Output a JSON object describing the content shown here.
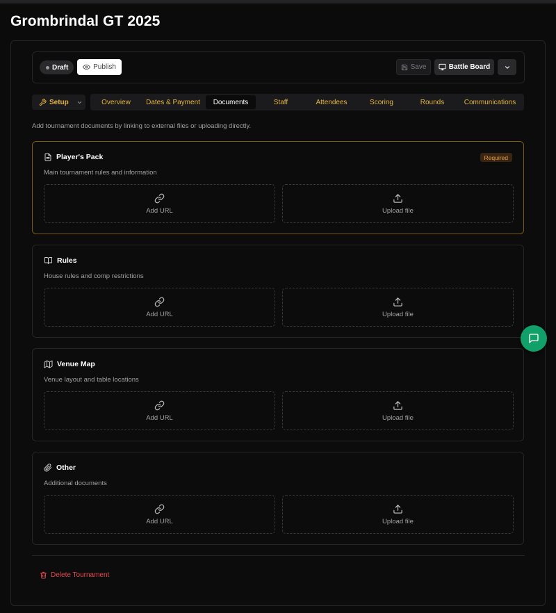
{
  "page": {
    "title": "Grombrindal GT 2025"
  },
  "toolbar": {
    "status_label": "Draft",
    "publish_label": "Publish",
    "save_label": "Save",
    "battle_board_label": "Battle Board"
  },
  "nav": {
    "setup_label": "Setup",
    "tabs": [
      {
        "label": "Overview"
      },
      {
        "label": "Dates & Payment"
      },
      {
        "label": "Documents"
      },
      {
        "label": "Staff"
      },
      {
        "label": "Attendees"
      },
      {
        "label": "Scoring"
      },
      {
        "label": "Rounds"
      },
      {
        "label": "Communications"
      }
    ],
    "active_tab": "Documents"
  },
  "intro": "Add tournament documents by linking to external files or uploading directly.",
  "documents": [
    {
      "title": "Player's Pack",
      "subtitle": "Main tournament rules and information",
      "badge": "Required",
      "icon": "file-text-icon",
      "url_label": "Add URL",
      "upload_label": "Upload file"
    },
    {
      "title": "Rules",
      "subtitle": "House rules and comp restrictions",
      "icon": "book-open-icon",
      "url_label": "Add URL",
      "upload_label": "Upload file"
    },
    {
      "title": "Venue Map",
      "subtitle": "Venue layout and table locations",
      "icon": "map-icon",
      "url_label": "Add URL",
      "upload_label": "Upload file"
    },
    {
      "title": "Other",
      "subtitle": "Additional documents",
      "icon": "paperclip-icon",
      "url_label": "Add URL",
      "upload_label": "Upload file"
    }
  ],
  "footer": {
    "delete_label": "Delete Tournament"
  },
  "colors": {
    "accent": "#e3b341",
    "danger": "#e5484d",
    "chat": "#12a06a",
    "required_border": "#7a5a17"
  }
}
